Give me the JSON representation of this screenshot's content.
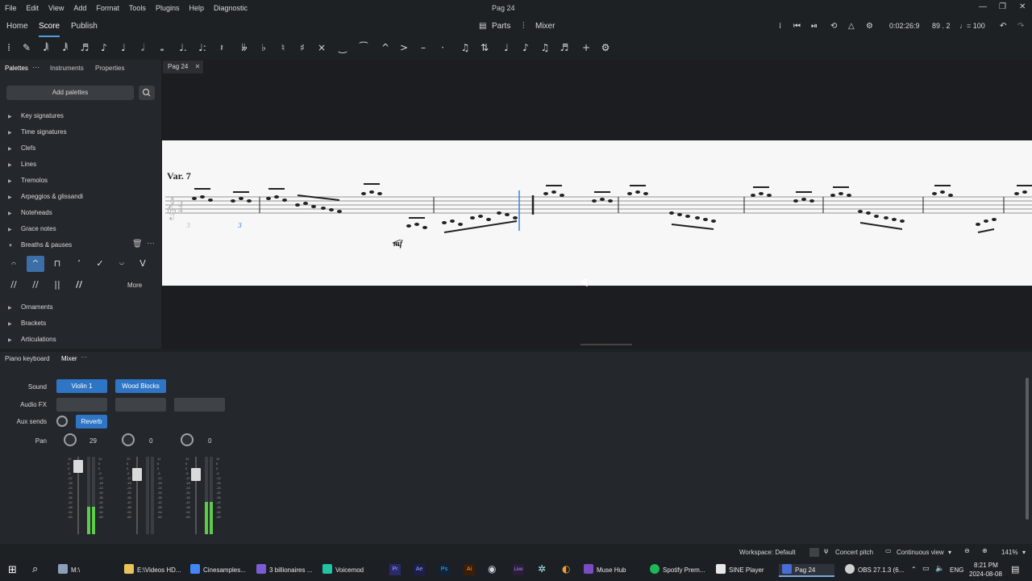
{
  "menubar": {
    "items": [
      "File",
      "Edit",
      "View",
      "Add",
      "Format",
      "Tools",
      "Plugins",
      "Help",
      "Diagnostic"
    ],
    "window_title": "Pag 24",
    "controls": [
      "—",
      "❐",
      "✕"
    ]
  },
  "topbar": {
    "tabs": [
      "Home",
      "Score",
      "Publish"
    ],
    "active_tab": "Score",
    "parts_label": "Parts",
    "mixer_label": "Mixer",
    "time": "0:02:26:9",
    "position": "89 . 2",
    "tempo": "♩= 100"
  },
  "toolbar": {
    "icons": [
      "grip-icon",
      "pencil-icon",
      "64th-note-icon",
      "32nd-note-icon",
      "16th-note-icon",
      "eighth-note-icon",
      "quarter-note-icon",
      "half-note-icon",
      "whole-note-icon",
      "augmentation-dot-icon",
      "double-dot-icon",
      "rest-icon",
      "double-flat-icon",
      "flat-icon",
      "natural-icon",
      "sharp-icon",
      "double-sharp-icon",
      "tie-icon",
      "slur-icon",
      "marcato-icon",
      "accent-icon",
      "tenuto-icon",
      "staccato-icon",
      "tuplet-icon",
      "flip-icon",
      "voice-1-icon",
      "voice-2-icon",
      "voice-3-icon",
      "voice-4-icon",
      "add-icon",
      "settings-icon"
    ]
  },
  "left_panel": {
    "tabs": [
      "Palettes",
      "Instruments",
      "Properties"
    ],
    "add_palettes": "Add palettes",
    "palettes": [
      "Key signatures",
      "Time signatures",
      "Clefs",
      "Lines",
      "Tremolos",
      "Arpeggios & glissandi",
      "Noteheads",
      "Grace notes",
      "Breaths & pauses"
    ],
    "palettes_after": [
      "Ornaments",
      "Brackets",
      "Articulations"
    ],
    "breaths_more": "More"
  },
  "score": {
    "tab_label": "Pag 24",
    "variation_title": "Var. 7",
    "dynamic": "mf",
    "triplet_label": "3"
  },
  "bottom": {
    "tabs": [
      "Piano keyboard",
      "Mixer"
    ],
    "labels": {
      "sound": "Sound",
      "audio_fx": "Audio FX",
      "aux_sends": "Aux sends",
      "pan": "Pan"
    },
    "channels": [
      {
        "sound": "Violin 1",
        "pan": "29",
        "reverb": "Reverb",
        "meter_level": 0.35
      },
      {
        "sound": "Wood Blocks",
        "pan": "0",
        "meter_level": 0.0
      },
      {
        "sound": "",
        "pan": "0",
        "meter_level": 0.42
      }
    ],
    "meter_scale": [
      "12",
      "6",
      "0",
      "-6",
      "-12",
      "-18",
      "-24",
      "-30",
      "-36",
      "-42",
      "-48",
      "-54",
      "-60"
    ]
  },
  "status": {
    "workspace": "Workspace: Default",
    "concert_pitch": "Concert pitch",
    "view_mode": "Continuous view",
    "zoom": "141%"
  },
  "taskbar": {
    "items": [
      {
        "label": "M:\\",
        "color": "#8aa0b8"
      },
      {
        "label": "E:\\Videos HD...",
        "color": "#e8c25a"
      },
      {
        "label": "Cinesamples...",
        "color": "#4285f4"
      },
      {
        "label": "3 billionaires ...",
        "color": "#7b5cd6"
      },
      {
        "label": "Voicemod",
        "color": "#20c4a0"
      },
      {
        "label": "Muse Hub",
        "color": "#7a4cc4"
      },
      {
        "label": "Spotify Prem...",
        "color": "#1db954"
      },
      {
        "label": "SINE Player",
        "color": "#e8e8e8"
      },
      {
        "label": "Pag 24",
        "color": "#4a6cd6"
      },
      {
        "label": "OBS 27.1.3 (6...",
        "color": "#d0d0d0"
      }
    ],
    "language": "ENG",
    "time": "8:21 PM",
    "date": "2024-08-08"
  },
  "colors": {
    "accent": "#2e75c6",
    "highlight": "#3c6ea8",
    "meter": "#5ccc4a"
  }
}
